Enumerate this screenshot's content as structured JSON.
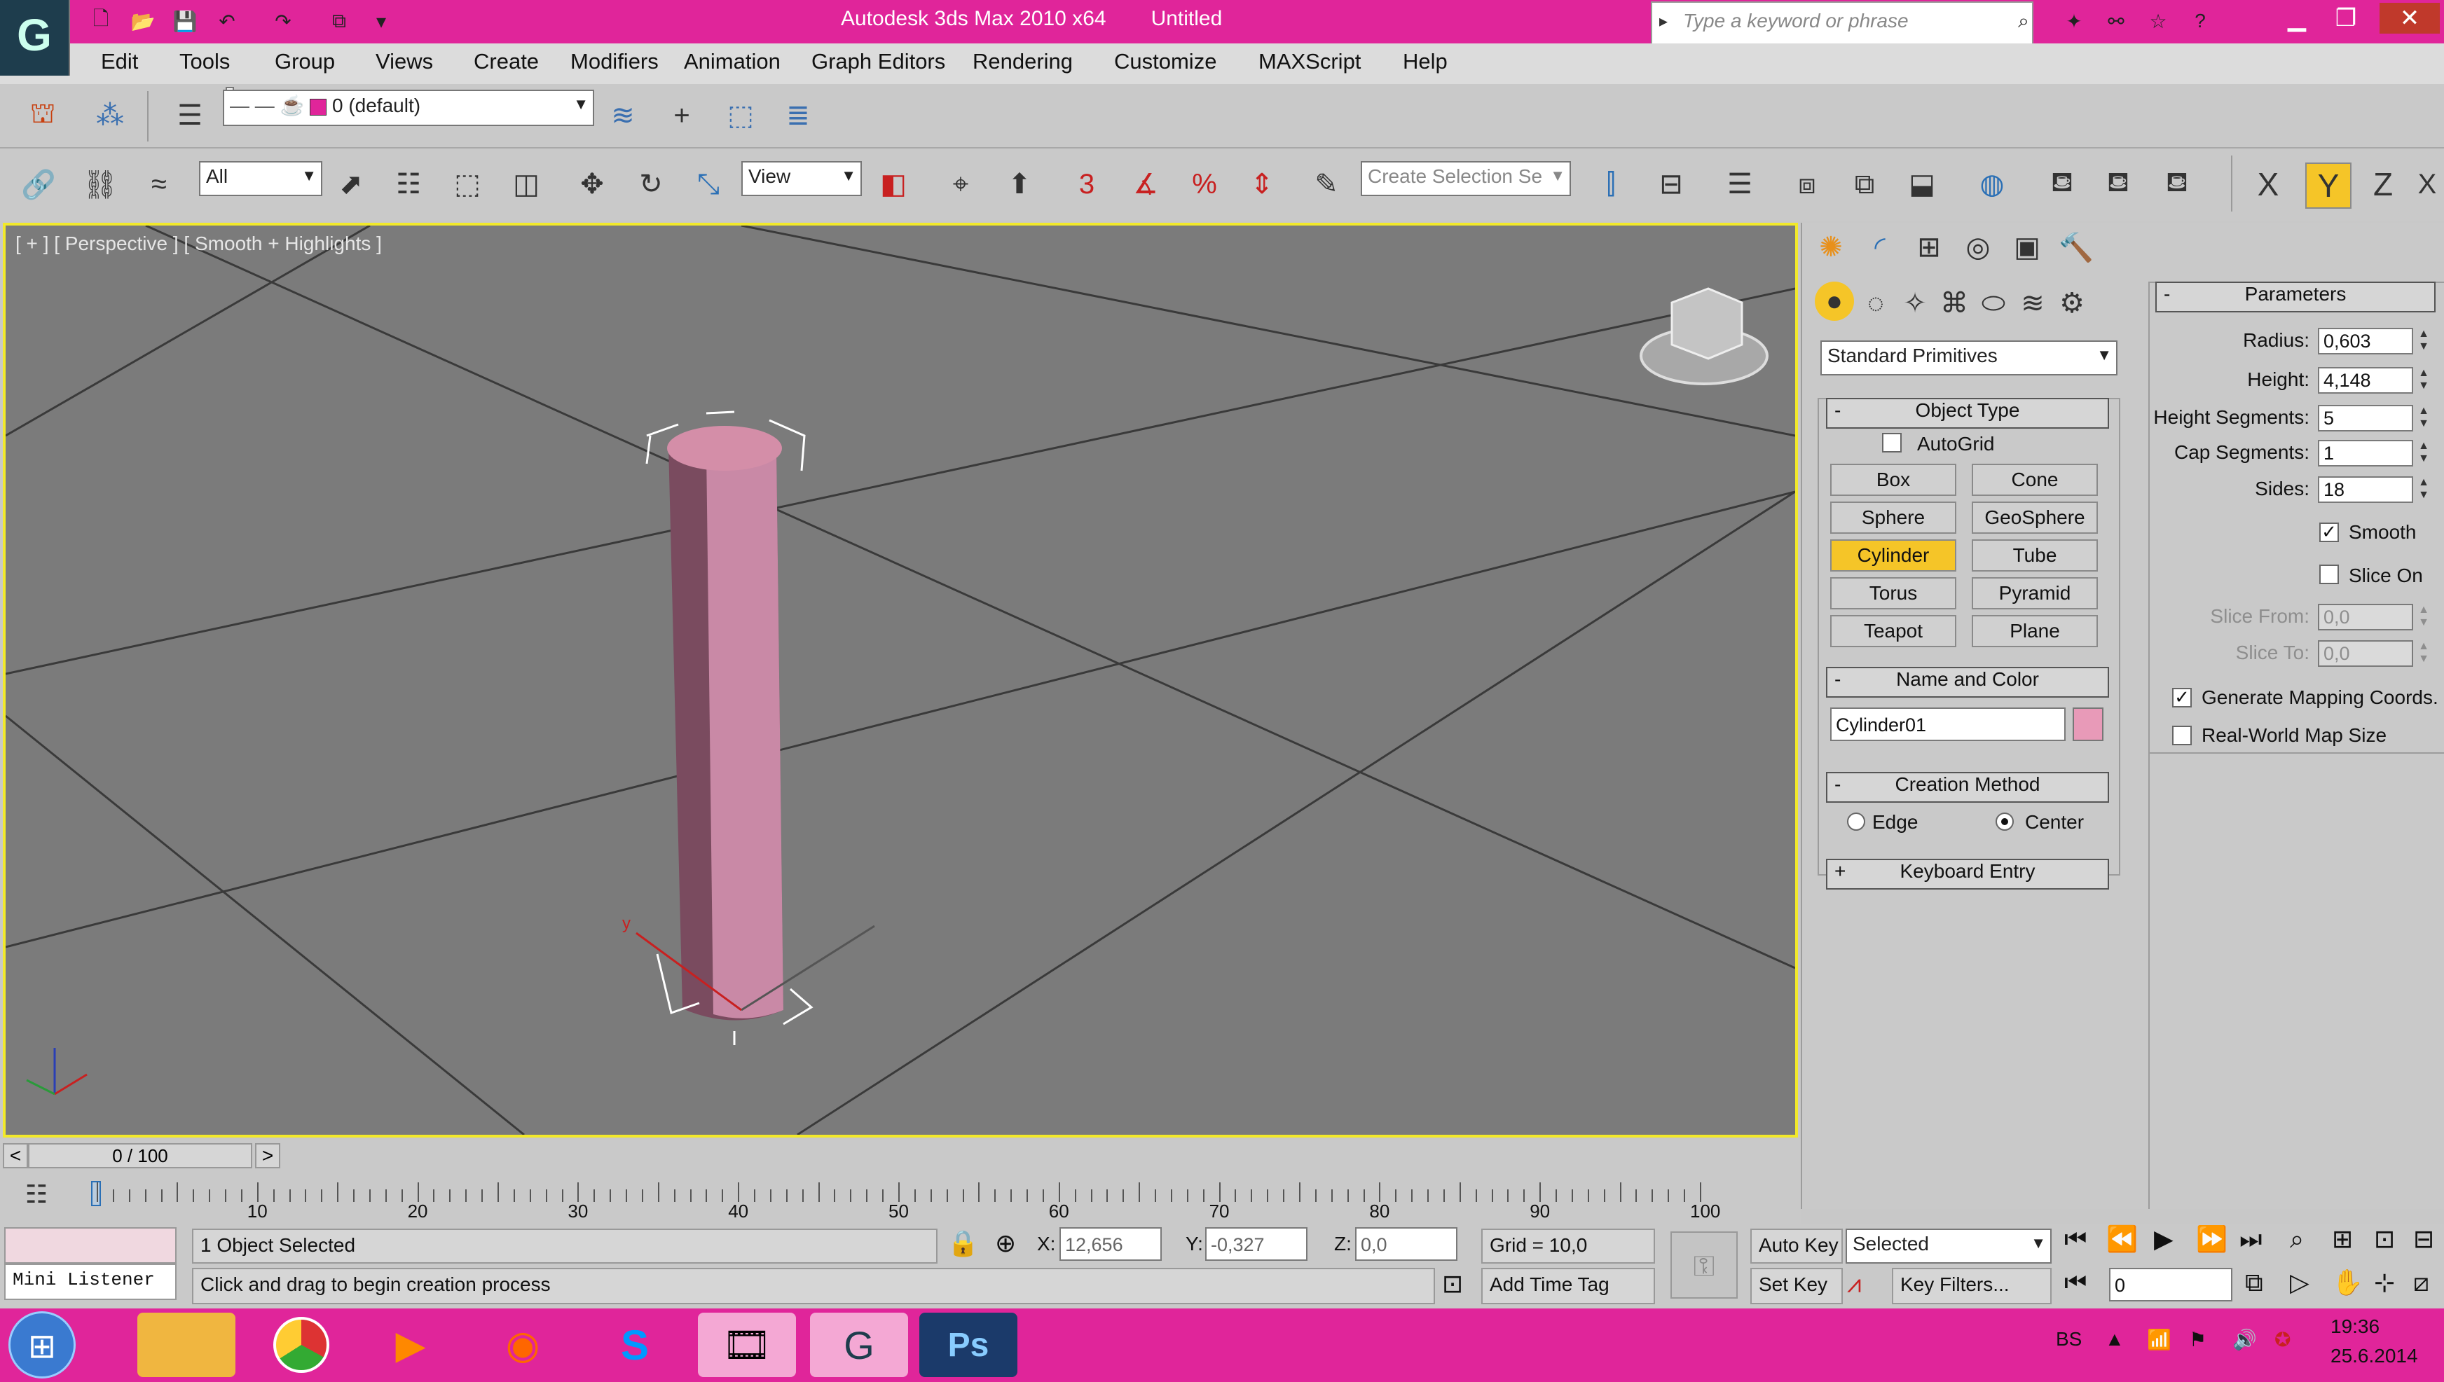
{
  "window": {
    "title": "Autodesk 3ds Max  2010 x64",
    "document": "Untitled",
    "search_placeholder": "Type a keyword or phrase"
  },
  "menu": [
    "Edit",
    "Tools",
    "Group",
    "Views",
    "Create",
    "Modifiers",
    "Animation",
    "Graph Editors",
    "Rendering",
    "Customize",
    "MAXScript",
    "Help"
  ],
  "toolbar1": {
    "layer": "0 (default)"
  },
  "toolbar2": {
    "selection_filter": "All",
    "ref_coord": "View",
    "named_selection_placeholder": "Create Selection Se",
    "axis_x": "X",
    "axis_y": "Y",
    "axis_z": "Z"
  },
  "viewport": {
    "label": "[ + ] [ Perspective ] [ Smooth + Highlights ]"
  },
  "create_panel": {
    "category": "Standard Primitives",
    "object_type": {
      "header": "Object Type",
      "autogrid": "AutoGrid",
      "buttons": [
        "Box",
        "Cone",
        "Sphere",
        "GeoSphere",
        "Cylinder",
        "Tube",
        "Torus",
        "Pyramid",
        "Teapot",
        "Plane"
      ],
      "active": "Cylinder"
    },
    "name_color": {
      "header": "Name and Color",
      "name": "Cylinder01",
      "color": "#e89ab8"
    },
    "creation_method": {
      "header": "Creation Method",
      "edge": "Edge",
      "center": "Center",
      "selected": "Center"
    },
    "keyboard_entry": {
      "header": "Keyboard Entry"
    }
  },
  "parameters": {
    "header": "Parameters",
    "radius_label": "Radius:",
    "radius": "0,603",
    "height_label": "Height:",
    "height": "4,148",
    "hseg_label": "Height Segments:",
    "hseg": "5",
    "capseg_label": "Cap Segments:",
    "capseg": "1",
    "sides_label": "Sides:",
    "sides": "18",
    "smooth": "Smooth",
    "smooth_checked": true,
    "slice_on": "Slice On",
    "slice_on_checked": false,
    "slice_from_label": "Slice From:",
    "slice_from": "0,0",
    "slice_to_label": "Slice To:",
    "slice_to": "0,0",
    "gen_mapping": "Generate Mapping Coords.",
    "gen_mapping_checked": true,
    "real_world": "Real-World Map Size",
    "real_world_checked": false
  },
  "timeline": {
    "frame": "0 / 100",
    "ticks": [
      "0",
      "10",
      "20",
      "30",
      "40",
      "50",
      "60",
      "70",
      "80",
      "90",
      "100"
    ]
  },
  "status": {
    "listener": "Mini Listener",
    "selected": "1 Object Selected",
    "prompt": "Click and drag to begin creation process",
    "x_label": "X:",
    "x": "12,656",
    "y_label": "Y:",
    "y": "-0,327",
    "z_label": "Z:",
    "z": "0,0",
    "grid": "Grid = 10,0",
    "add_time_tag": "Add Time Tag",
    "auto_key": "Auto Key",
    "set_key": "Set Key",
    "key_mode": "Selected",
    "key_filters": "Key Filters...",
    "current_frame": "0"
  },
  "taskbar": {
    "lang": "BS",
    "time": "19:36",
    "date": "25.6.2014"
  }
}
